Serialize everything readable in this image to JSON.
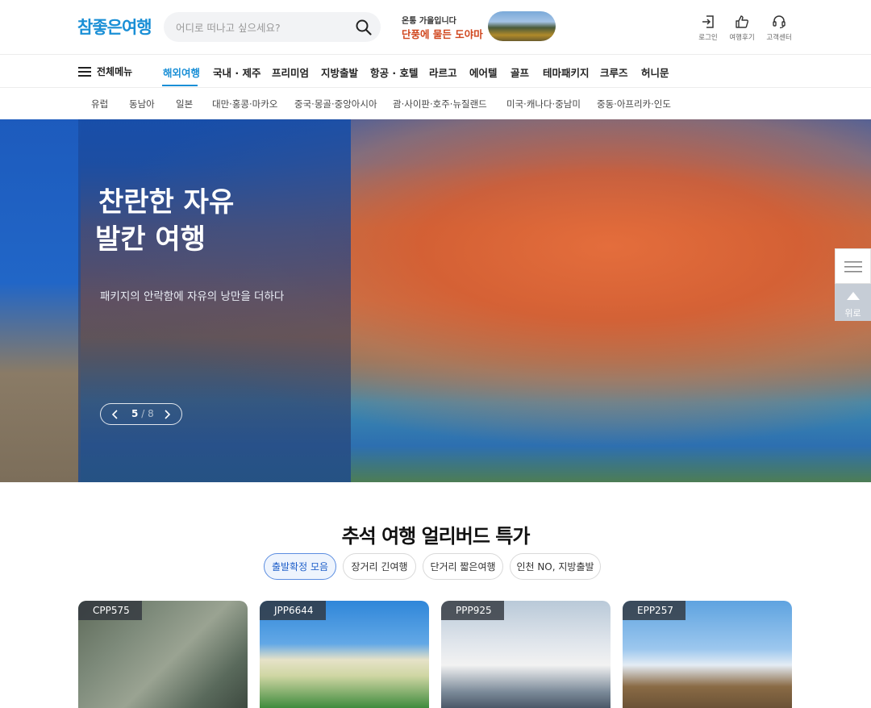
{
  "header": {
    "logo": "참좋은여행",
    "search_placeholder": "어디로 떠나고 싶으세요?",
    "promo_sub": "온통 가을입니다",
    "promo_main": "단풍에 물든 도야마",
    "utils": [
      {
        "label": "로그인",
        "icon": "login-icon"
      },
      {
        "label": "여행후기",
        "icon": "thumbs-up-icon"
      },
      {
        "label": "고객센터",
        "icon": "headset-icon"
      }
    ]
  },
  "gnb": {
    "all_menu": "전체메뉴",
    "items": [
      "해외여행",
      "국내 · 제주",
      "프리미엄",
      "지방출발",
      "항공 · 호텔",
      "라르고",
      "에어텔",
      "골프",
      "테마패키지",
      "크루즈",
      "허니문"
    ],
    "active_index": 0
  },
  "subnav": {
    "items": [
      "유럽",
      "동남아",
      "일본",
      "대만·홍콩·마카오",
      "중국·몽골·중앙아시아",
      "괌·사이판·호주·뉴질랜드",
      "미국·캐나다·중남미",
      "중동·아프리카·인도"
    ]
  },
  "hero": {
    "title_line1": "찬란한 자유",
    "title_line2": "발칸 여행",
    "description": "패키지의 안락함에 자유의 낭만을 더하다",
    "current": "5",
    "separator": "/",
    "total": "8"
  },
  "side": {
    "top_label": "위로"
  },
  "section": {
    "title": "추석 여행 얼리버드 특가",
    "chips": [
      "출발확정 모음",
      "장거리 긴여행",
      "단거리 짧은여행",
      "인천 NO, 지방출발"
    ],
    "active_chip": 0
  },
  "cards": [
    {
      "code": "CPP575"
    },
    {
      "code": "JPP6644"
    },
    {
      "code": "PPP925"
    },
    {
      "code": "EPP257"
    }
  ],
  "colors": {
    "brand": "#1a8fd6",
    "promo": "#d0461d",
    "chip_active": "#1f5fc9"
  }
}
